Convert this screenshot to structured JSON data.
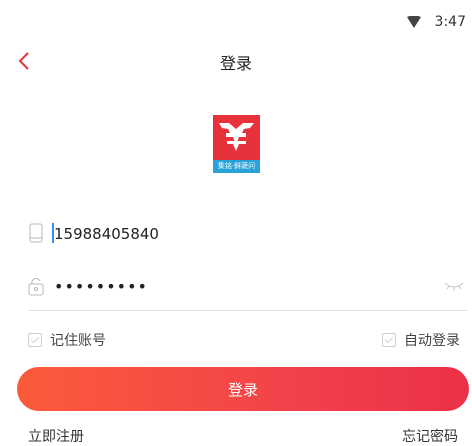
{
  "status_bar": {
    "time": "3:47",
    "wifi_icon": "wifi-icon"
  },
  "header": {
    "title": "登录",
    "back_icon": "chevron-left-icon"
  },
  "logo": {
    "caption": "集铭·鲜蔬问"
  },
  "form": {
    "phone": {
      "value": "15988405840",
      "icon": "phone-icon"
    },
    "password": {
      "value": "•••••••••",
      "icon": "lock-icon",
      "toggle_icon": "eye-closed-icon"
    }
  },
  "options": {
    "remember_account": {
      "label": "记住账号",
      "checked": false
    },
    "auto_login": {
      "label": "自动登录",
      "checked": false
    }
  },
  "actions": {
    "login_label": "登录",
    "register_label": "立即注册",
    "forgot_label": "忘记密码"
  },
  "colors": {
    "accent": "#f2424a",
    "gradient_start": "#fb5b3a",
    "gradient_end": "#ec3048",
    "logo_red": "#e7323b",
    "logo_blue": "#29a2d8"
  }
}
